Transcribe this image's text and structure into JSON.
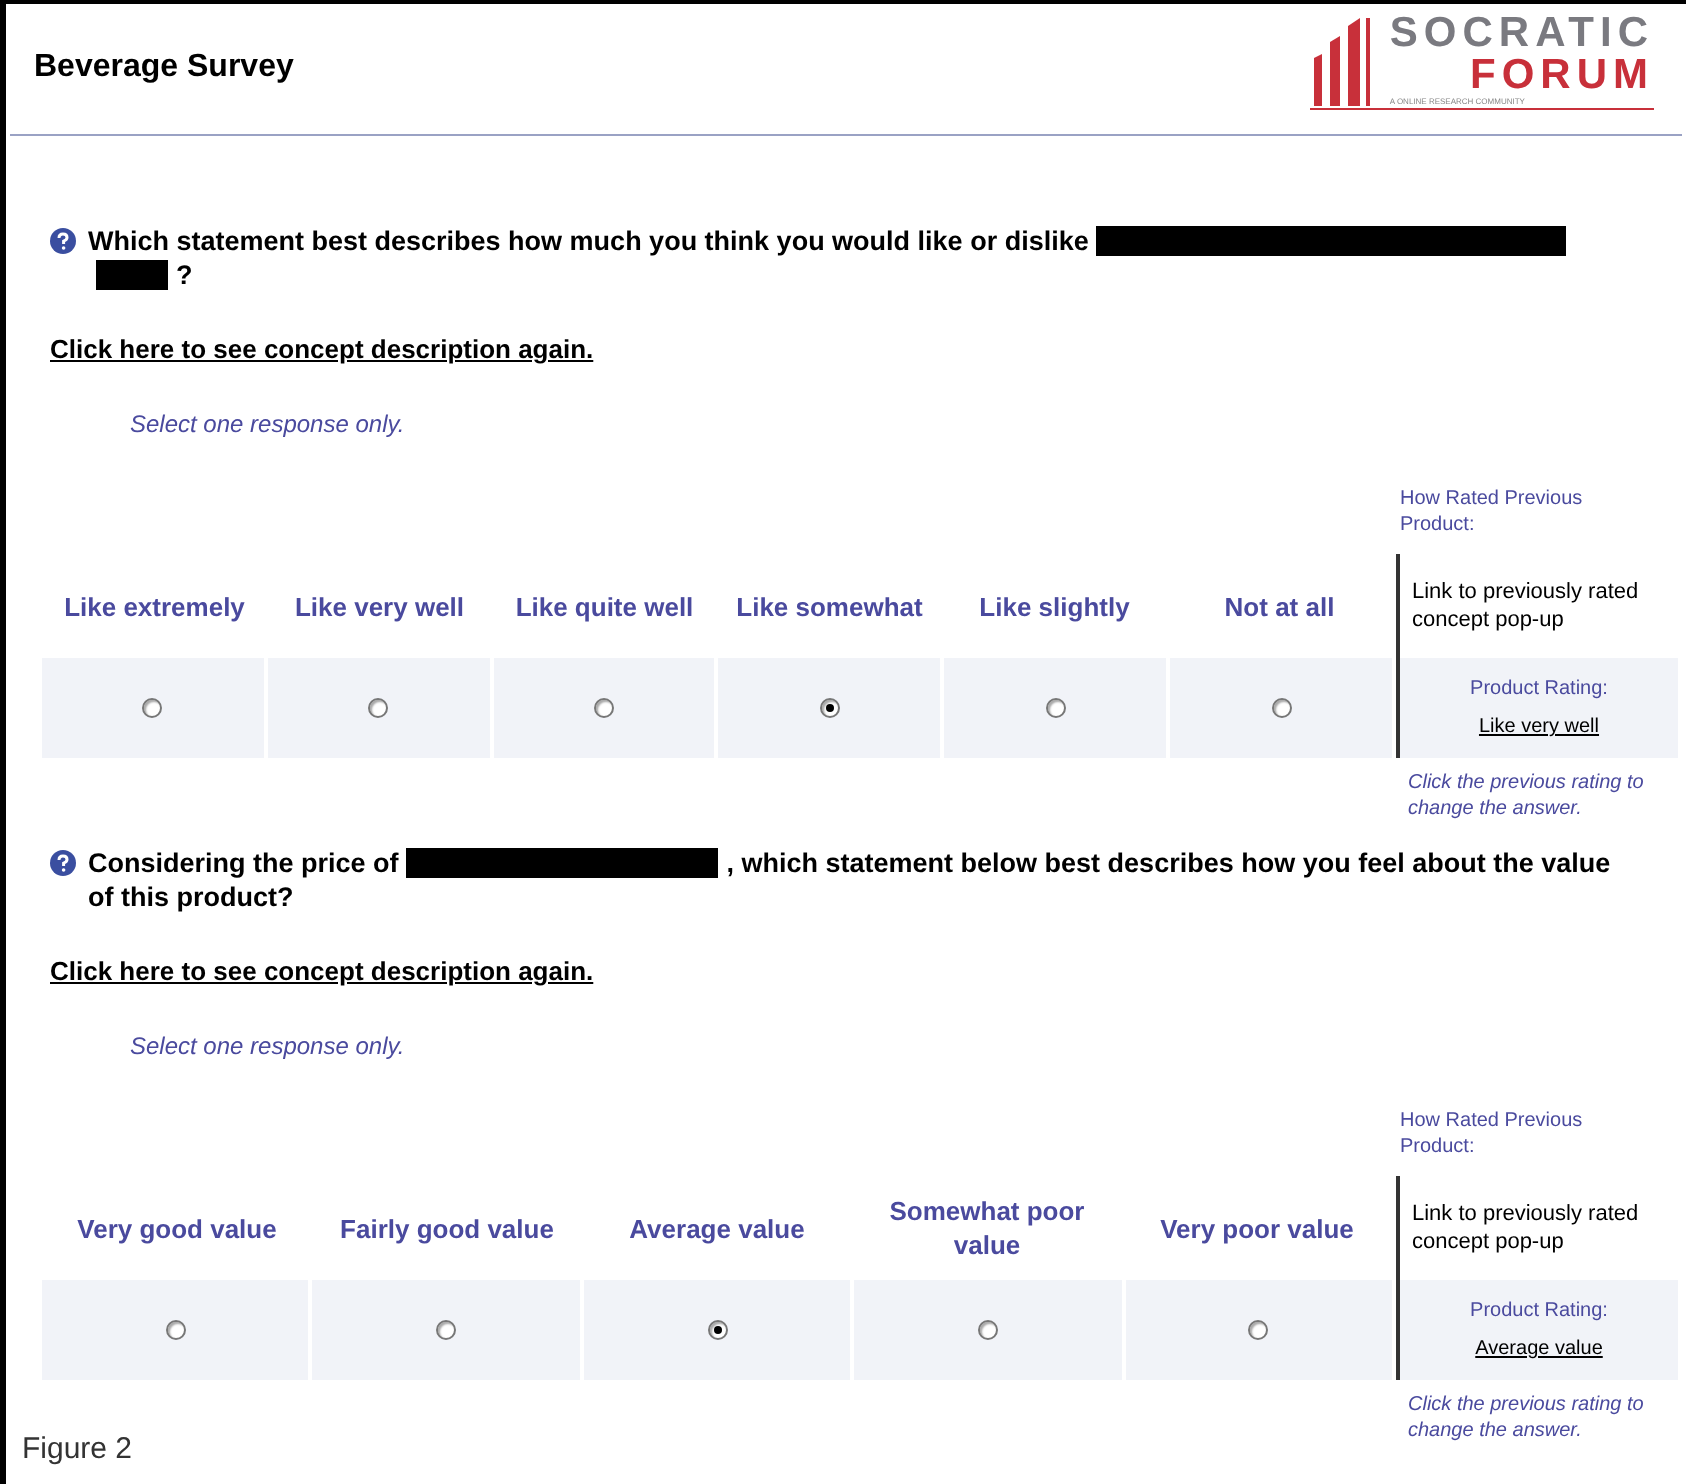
{
  "header": {
    "title": "Beverage Survey",
    "logo": {
      "word_top": "SOCRATIC",
      "word_bottom": "FORUM",
      "tagline": "A ONLINE RESEARCH COMMUNITY"
    }
  },
  "questions": [
    {
      "parts": [
        {
          "kind": "text",
          "text": "Which statement best describes how much you think you would like or dislike"
        },
        {
          "kind": "redaction_wide"
        },
        {
          "kind": "redaction_narrow"
        },
        {
          "kind": "text",
          "text": "?"
        }
      ],
      "link": "Click here to see concept description again.",
      "instruction": "Select one response only.",
      "options": [
        {
          "label": "Like extremely",
          "selected": false
        },
        {
          "label": "Like very well",
          "selected": false
        },
        {
          "label": "Like quite well",
          "selected": false
        },
        {
          "label": "Like somewhat",
          "selected": true
        },
        {
          "label": "Like slightly",
          "selected": false
        },
        {
          "label": "Not at all",
          "selected": false
        }
      ],
      "previous": {
        "heading": "How Rated Previous Product:",
        "popup_link": "Link to previously rated concept pop-up",
        "rating_label": "Product Rating:",
        "rating": "Like very well",
        "note": "Click the previous rating to change the answer."
      }
    },
    {
      "parts": [
        {
          "kind": "text",
          "text": "Considering the price of"
        },
        {
          "kind": "redaction_medium"
        },
        {
          "kind": "text",
          "text": ", which statement below best describes how you feel about the value of this product?"
        }
      ],
      "link": "Click here to see concept description again.",
      "instruction": "Select one response only.",
      "options": [
        {
          "label": "Very good value",
          "selected": false
        },
        {
          "label": "Fairly good value",
          "selected": false
        },
        {
          "label": "Average value",
          "selected": true
        },
        {
          "label": "Somewhat poor value",
          "selected": false
        },
        {
          "label": "Very poor value",
          "selected": false
        }
      ],
      "previous": {
        "heading": "How Rated Previous Product:",
        "popup_link": "Link to previously rated concept pop-up",
        "rating_label": "Product Rating:",
        "rating": "Average value",
        "note": "Click the previous rating to change the answer."
      }
    }
  ],
  "caption": "Figure 2"
}
